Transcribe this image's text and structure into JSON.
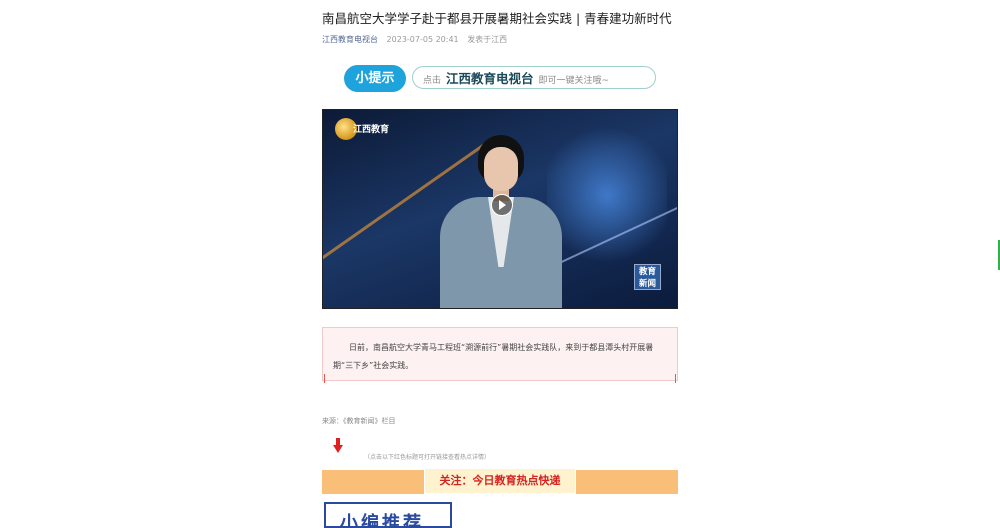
{
  "article": {
    "title": "南昌航空大学学子赴于都县开展暑期社会实践 | 青春建功新时代",
    "account": "江西教育电视台",
    "date": "2023-07-05 20:41",
    "location": "发表于江西"
  },
  "tip": {
    "badge": "小提示",
    "prefix": "点击",
    "channel": "江西教育电视台",
    "suffix": "即可一键关注哦~"
  },
  "video": {
    "logo_text": "江西教育",
    "badge_line1": "教育",
    "badge_line2": "新闻"
  },
  "body": {
    "paragraph": "日前，南昌航空大学青马工程班“溯源前行”暑期社会实践队，来到于都县潭头村开展暑期“三下乡”社会实践。"
  },
  "source": "来源：《教育新闻》栏目",
  "hint": "（点击以下红色标题可打开链接查看热点详情）",
  "focus_bar": "关注：今日教育热点快递",
  "recommend": "小编推荐",
  "colors": {
    "accent_blue": "#1fa3dc",
    "link": "#576b95",
    "bar_orange": "#f9be78",
    "focus_red": "#d52222"
  }
}
